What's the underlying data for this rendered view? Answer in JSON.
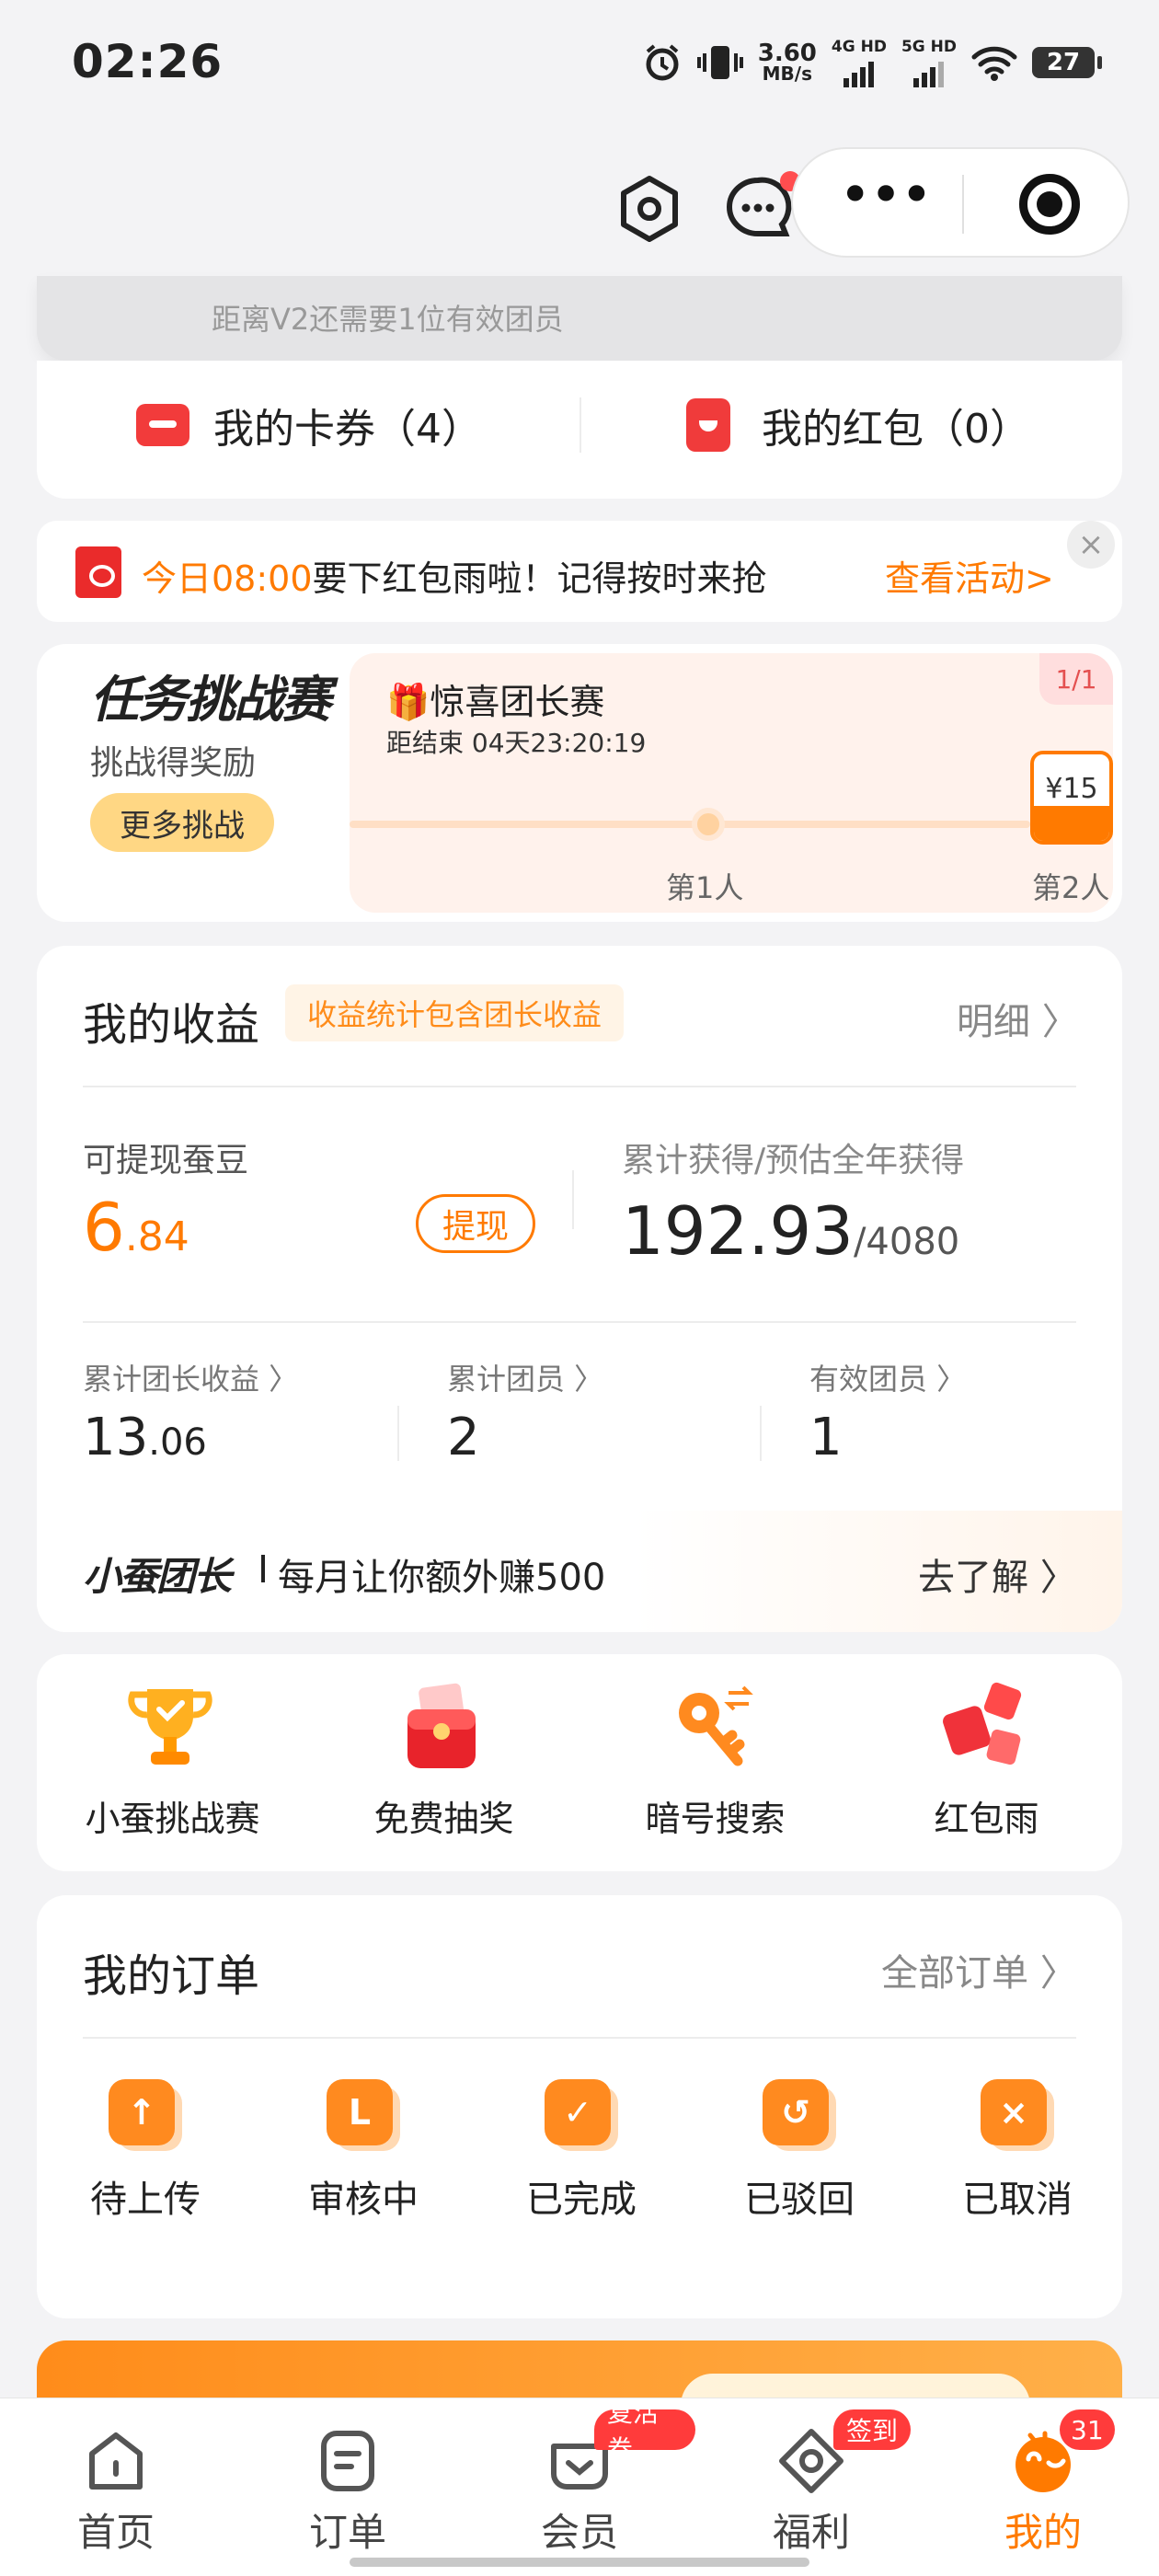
{
  "status_bar": {
    "time": "02:26",
    "net_speed": "3.60",
    "net_unit": "MB/s",
    "sig1": "4G HD",
    "sig2": "5G HD",
    "battery": "27"
  },
  "level_hint": "距离V2还需要1位有效团员",
  "wallet": {
    "coupons": "我的卡券（4）",
    "red_packets": "我的红包（0）"
  },
  "notice": {
    "time": "今日08:00",
    "text": "要下红包雨啦！记得按时来抢",
    "action": "查看活动>",
    "close": "×"
  },
  "task": {
    "title": "任务挑战赛",
    "subtitle": "挑战得奖励",
    "more": "更多挑战",
    "contest_name": "🎁惊喜团长赛",
    "countdown": "距结束 04天23:20:19",
    "page": "1/1",
    "reward": "¥15",
    "step1": "第1人",
    "step2": "第2人"
  },
  "income": {
    "title": "我的收益",
    "tag": "收益统计包含团长收益",
    "detail": "明细 〉",
    "withdrawable_label": "可提现蚕豆",
    "withdrawable_int": "6",
    "withdrawable_dec": ".84",
    "withdraw_btn": "提现",
    "total_label": "累计获得/预估全年获得",
    "total_value": "192.93",
    "total_est": "/4080",
    "stats": [
      {
        "label": "累计团长收益 〉",
        "int": "13",
        "dec": ".06"
      },
      {
        "label": "累计团员 〉",
        "int": "2",
        "dec": ""
      },
      {
        "label": "有效团员 〉",
        "int": "1",
        "dec": ""
      }
    ],
    "leader_logo": "小蚕团长",
    "leader_text": "每月让你额外赚500",
    "leader_go": "去了解 〉"
  },
  "features": [
    {
      "label": "小蚕挑战赛",
      "icon": "trophy-icon"
    },
    {
      "label": "免费抽奖",
      "icon": "lottery-box-icon"
    },
    {
      "label": "暗号搜索",
      "icon": "key-icon"
    },
    {
      "label": "红包雨",
      "icon": "red-packet-rain-icon"
    }
  ],
  "orders": {
    "title": "我的订单",
    "all": "全部订单 〉",
    "items": [
      {
        "label": "待上传",
        "glyph": "↑"
      },
      {
        "label": "审核中",
        "glyph": "L"
      },
      {
        "label": "已完成",
        "glyph": "✓"
      },
      {
        "label": "已驳回",
        "glyph": "↺"
      },
      {
        "label": "已取消",
        "glyph": "×"
      }
    ]
  },
  "tabs": [
    {
      "label": "首页",
      "badge": ""
    },
    {
      "label": "订单",
      "badge": ""
    },
    {
      "label": "会员",
      "badge": "复活券"
    },
    {
      "label": "福利",
      "badge": "签到"
    },
    {
      "label": "我的",
      "badge": "31"
    }
  ],
  "colors": {
    "accent": "#ff7a00",
    "red": "#f03b3b",
    "active_tab": "#ff7a00"
  }
}
